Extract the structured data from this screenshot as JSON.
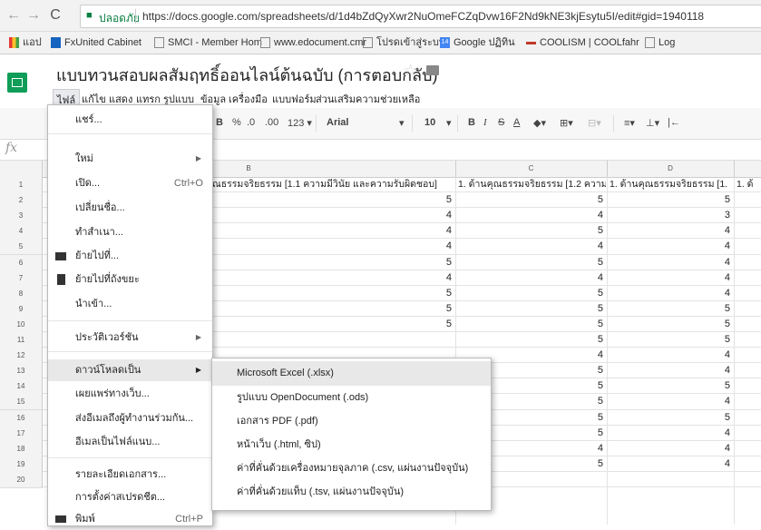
{
  "browser": {
    "secure_label": "ปลอดภัย",
    "url": "https://docs.google.com/spreadsheets/d/1d4bZdQyXwr2NuOmeFCZqDvw16F2Nd9kNE3kjEsytu5I/edit#gid=1940118",
    "bookmarks": [
      {
        "label": "แอป",
        "icon": "apps-grid-icon",
        "color": "#e53935"
      },
      {
        "label": "FxUnited Cabinet",
        "icon": "fx-favicon",
        "color": "#1565c0"
      },
      {
        "label": "SMCI - Member Hom",
        "icon": "page-icon",
        "color": "#888888"
      },
      {
        "label": "www.edocument.cmr",
        "icon": "page-icon",
        "color": "#888888"
      },
      {
        "label": "โปรดเข้าสู่ระบบ",
        "icon": "page-icon",
        "color": "#888888"
      },
      {
        "label": "Google ปฏิทิน",
        "icon": "calendar-icon",
        "color": "#4285f4",
        "badge": "14"
      },
      {
        "label": "COOLISM | COOLfahr",
        "icon": "coolism-favicon",
        "color": "#c0392b"
      },
      {
        "label": "Log",
        "icon": "page-icon",
        "color": "#888888"
      }
    ]
  },
  "doc": {
    "title": "แบบทวนสอบผลสัมฤทธิ์ออนไลน์ต้นฉบับ (การตอบกลับ)",
    "menus": [
      "ไฟล์",
      "แก้ไข",
      "แสดง",
      "แทรก",
      "รูปแบบ",
      "ข้อมูล",
      "เครื่องมือ",
      "แบบฟอร์ม",
      "ส่วนเสริม",
      "ความช่วยเหลือ"
    ]
  },
  "toolbar": {
    "bold": "B",
    "percent": "%",
    "dec_less": ".0",
    "dec_more": ".00",
    "format_more": "123 ▾",
    "font": "Arial",
    "size": "10",
    "italic": "I",
    "strike": "S",
    "text_color": "A"
  },
  "sheet": {
    "columns": [
      "B",
      "C",
      "D"
    ],
    "row_numbers": [
      "1",
      "2",
      "3",
      "4",
      "5",
      "6",
      "7",
      "8",
      "9",
      "10",
      "11",
      "12",
      "13",
      "14",
      "15",
      "16",
      "17",
      "18",
      "19",
      "20"
    ],
    "header_b": "ณธรรมจริยธรรม [1.1 ความมีวินัย และความรับผิดชอบ]",
    "header_c": "1. ด้านคุณธรรมจริยธรรม [1.2 ความ",
    "header_d": "1. ด้านคุณธรรมจริยธรรม [1.",
    "header_e": "1. ด้",
    "col_b": [
      "5",
      "4",
      "4",
      "4",
      "5",
      "4",
      "5",
      "5",
      "5",
      "",
      "",
      "",
      "",
      "",
      "",
      "",
      "",
      ""
    ],
    "col_c": [
      "5",
      "4",
      "5",
      "4",
      "5",
      "4",
      "5",
      "5",
      "5",
      "5",
      "4",
      "5",
      "5",
      "5",
      "5",
      "5",
      "4",
      "5"
    ],
    "col_d": [
      "5",
      "3",
      "4",
      "4",
      "4",
      "4",
      "4",
      "5",
      "5",
      "5",
      "4",
      "4",
      "5",
      "4",
      "5",
      "4",
      "4",
      "4"
    ]
  },
  "file_menu": {
    "items": [
      {
        "label": "แชร์...",
        "shortcut": "",
        "submenu": false
      },
      {
        "label": "ใหม่",
        "shortcut": "",
        "submenu": true
      },
      {
        "label": "เปิด...",
        "shortcut": "Ctrl+O",
        "submenu": false
      },
      {
        "label": "เปลี่ยนชื่อ...",
        "shortcut": "",
        "submenu": false
      },
      {
        "label": "ทำสำเนา...",
        "shortcut": "",
        "submenu": false
      },
      {
        "label": "ย้ายไปที่...",
        "shortcut": "",
        "submenu": false,
        "icon": "folder-icon"
      },
      {
        "label": "ย้ายไปที่ถังขยะ",
        "shortcut": "",
        "submenu": false,
        "icon": "trash-icon"
      },
      {
        "label": "นำเข้า...",
        "shortcut": "",
        "submenu": false
      },
      {
        "label": "ประวัติเวอร์ชัน",
        "shortcut": "",
        "submenu": true
      },
      {
        "label": "ดาวน์โหลดเป็น",
        "shortcut": "",
        "submenu": true
      },
      {
        "label": "เผยแพร่ทางเว็บ...",
        "shortcut": "",
        "submenu": false
      },
      {
        "label": "ส่งอีเมลถึงผู้ทำงานร่วมกัน...",
        "shortcut": "",
        "submenu": false
      },
      {
        "label": "อีเมลเป็นไฟล์แนบ...",
        "shortcut": "",
        "submenu": false
      },
      {
        "label": "รายละเอียดเอกสาร...",
        "shortcut": "",
        "submenu": false
      },
      {
        "label": "การตั้งค่าสเปรดชีต...",
        "shortcut": "",
        "submenu": false
      },
      {
        "label": "พิมพ์",
        "shortcut": "Ctrl+P",
        "submenu": false,
        "icon": "print-icon"
      }
    ]
  },
  "download_submenu": {
    "items": [
      "Microsoft Excel (.xlsx)",
      "รูปแบบ OpenDocument (.ods)",
      "เอกสาร PDF (.pdf)",
      "หน้าเว็บ (.html, ซิป)",
      "ค่าที่คั่นด้วยเครื่องหมายจุลภาค (.csv, แผ่นงานปัจจุบัน)",
      "ค่าที่คั่นด้วยแท็บ (.tsv, แผ่นงานปัจจุบัน)"
    ]
  },
  "colors": {
    "secure": "#0b8043",
    "sheets_green": "#0f9d58",
    "menu_highlight": "#e8e8e8"
  }
}
